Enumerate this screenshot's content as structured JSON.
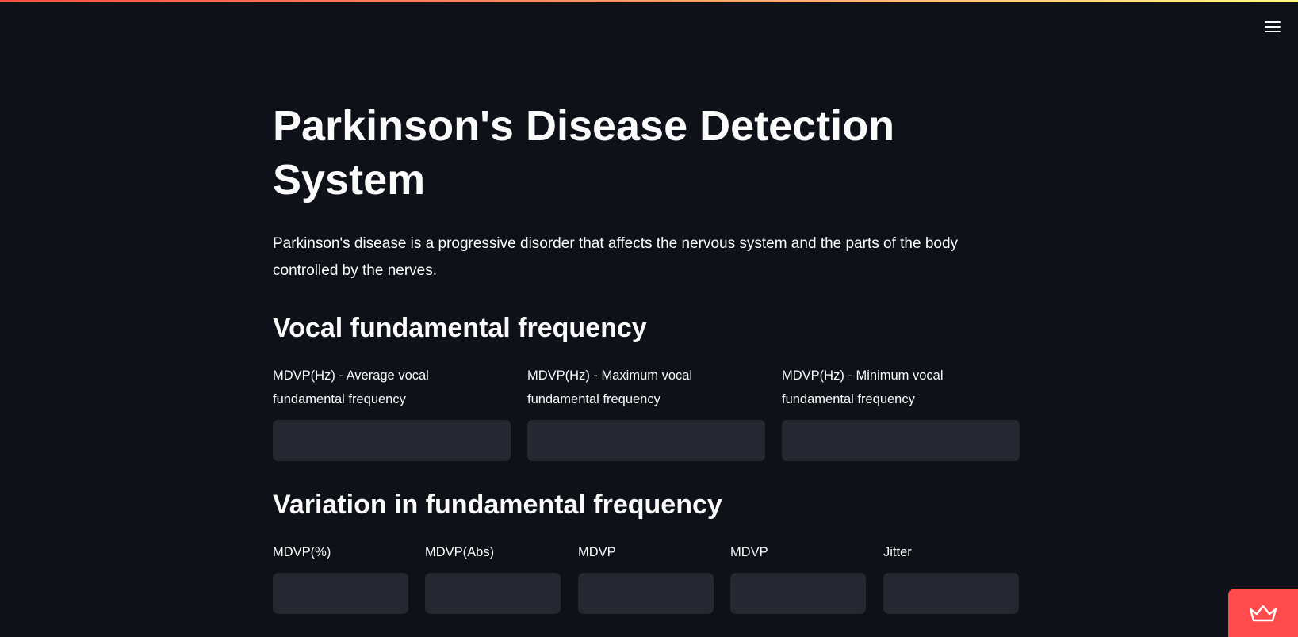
{
  "header": {
    "menu_icon": "hamburger-icon"
  },
  "main": {
    "title": "Parkinson's Disease Detection System",
    "description": "Parkinson's disease is a progressive disorder that affects the nervous system and the parts of the body controlled by the nerves.",
    "sections": [
      {
        "title": "Vocal fundamental frequency",
        "fields": [
          {
            "label": "MDVP(Hz) - Average vocal fundamental frequency",
            "value": "",
            "placeholder": ""
          },
          {
            "label": "MDVP(Hz) - Maximum vocal fundamental frequency",
            "value": "",
            "placeholder": ""
          },
          {
            "label": "MDVP(Hz) - Minimum vocal fundamental frequency",
            "value": "",
            "placeholder": ""
          }
        ]
      },
      {
        "title": "Variation in fundamental frequency",
        "fields": [
          {
            "label": "MDVP(%)",
            "value": "",
            "placeholder": ""
          },
          {
            "label": "MDVP(Abs)",
            "value": "",
            "placeholder": ""
          },
          {
            "label": "MDVP",
            "value": "",
            "placeholder": ""
          },
          {
            "label": "MDVP",
            "value": "",
            "placeholder": ""
          },
          {
            "label": "Jitter",
            "value": "",
            "placeholder": ""
          }
        ]
      }
    ]
  },
  "badge": {
    "icon": "crown-icon"
  },
  "colors": {
    "background": "#0e1117",
    "input_background": "#262730",
    "accent": "#ff4b4b",
    "text": "#fafafa"
  }
}
